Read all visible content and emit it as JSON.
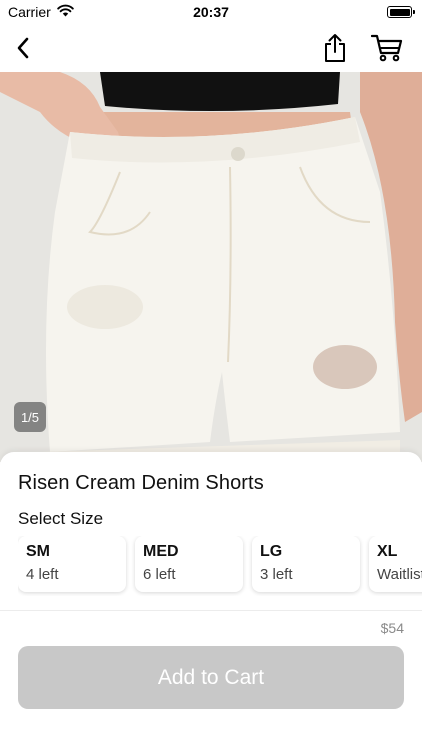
{
  "status_bar": {
    "carrier": "Carrier",
    "time": "20:37",
    "wifi_icon": "wifi-icon",
    "battery_icon": "battery-icon"
  },
  "nav": {
    "back_icon": "chevron-left-icon",
    "share_icon": "share-icon",
    "cart_icon": "cart-icon"
  },
  "gallery": {
    "counter": "1/5"
  },
  "product": {
    "title": "Risen Cream Denim Shorts",
    "size_heading": "Select Size",
    "sizes": [
      {
        "name": "SM",
        "stock": "4 left"
      },
      {
        "name": "MED",
        "stock": "6 left"
      },
      {
        "name": "LG",
        "stock": "3 left"
      },
      {
        "name": "XL",
        "stock": "Waitlist"
      }
    ],
    "price": "$54",
    "add_to_cart_label": "Add to Cart"
  },
  "colors": {
    "button_disabled": "#c8c8c8",
    "price_text": "#8a8a8a",
    "shorts": "#f6f4ee",
    "top": "#111111",
    "skin": "#e6b9a3"
  }
}
